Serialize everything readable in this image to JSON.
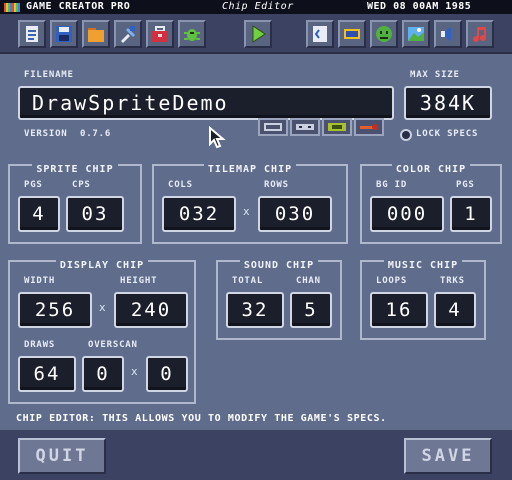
{
  "menubar": {
    "app_name": "GAME CREATOR PRO",
    "window_title": "Chip Editor",
    "datetime": "WED 08 00AM 1985"
  },
  "toolbar": {
    "left_icons": [
      "new-document-icon",
      "save-disk-icon",
      "folder-icon",
      "tools-icon",
      "toolbox-icon",
      "bug-icon"
    ],
    "play_icon": "play-icon",
    "right_icons": [
      "code-icon",
      "sprite-editor-icon",
      "face-icon",
      "image-icon",
      "speaker-icon",
      "music-icon"
    ]
  },
  "filename": {
    "label": "FILENAME",
    "value": "DrawSpriteDemo"
  },
  "max_size": {
    "label": "MAX SIZE",
    "value": "384K"
  },
  "version": {
    "label": "VERSION",
    "value": "0.7.6"
  },
  "lock_specs": {
    "label": "LOCK SPECS"
  },
  "sprite_chip": {
    "title": "SPRITE CHIP",
    "pgs_label": "PGS",
    "pgs_value": "4",
    "cps_label": "CPS",
    "cps_value": "03"
  },
  "tilemap_chip": {
    "title": "TILEMAP CHIP",
    "cols_label": "COLS",
    "cols_value": "032",
    "rows_label": "ROWS",
    "rows_value": "030",
    "times": "x"
  },
  "color_chip": {
    "title": "COLOR CHIP",
    "bgid_label": "BG ID",
    "bgid_value": "000",
    "pgs_label": "PGS",
    "pgs_value": "1"
  },
  "display_chip": {
    "title": "DISPLAY CHIP",
    "width_label": "WIDTH",
    "width_value": "256",
    "height_label": "HEIGHT",
    "height_value": "240",
    "draws_label": "DRAWS",
    "draws_value": "64",
    "overscan_label": "OVERSCAN",
    "overscan_x": "0",
    "overscan_y": "0",
    "times": "x"
  },
  "sound_chip": {
    "title": "SOUND CHIP",
    "total_label": "TOTAL",
    "total_value": "32",
    "chan_label": "CHAN",
    "chan_value": "5"
  },
  "music_chip": {
    "title": "MUSIC CHIP",
    "loops_label": "LOOPS",
    "loops_value": "16",
    "trks_label": "TRKS",
    "trks_value": "4"
  },
  "hint": "CHIP EDITOR: THIS ALLOWS YOU TO MODIFY THE GAME'S SPECS.",
  "buttons": {
    "quit": "QUIT",
    "save": "SAVE"
  },
  "colors": {
    "background": "#5f6c8c",
    "menubar": "#0d0f1a",
    "toolbar": "#3b4262",
    "field": "#1b1e2b"
  }
}
